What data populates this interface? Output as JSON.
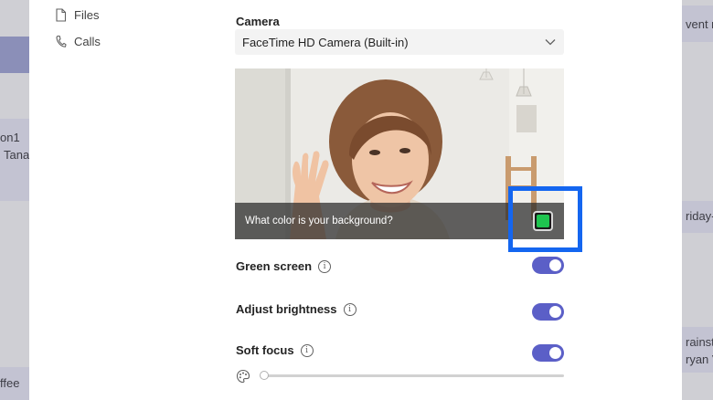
{
  "background_app": {
    "left_texts": [
      "on1",
      "Tana",
      "ffee"
    ],
    "right_texts": [
      "vent n",
      "riday-",
      "rainst",
      "ryan V"
    ]
  },
  "nav": {
    "files_label": "Files",
    "calls_label": "Calls"
  },
  "camera": {
    "label": "Camera",
    "selected_device": "FaceTime HD Camera (Built-in)"
  },
  "preview": {
    "prompt": "What color is your background?",
    "swatch_color": "#1ec44f"
  },
  "settings": [
    {
      "label": "Green screen",
      "enabled": true
    },
    {
      "label": "Adjust brightness",
      "enabled": true
    },
    {
      "label": "Soft focus",
      "enabled": true
    }
  ],
  "soft_focus_level": 0,
  "colors": {
    "accent": "#5b5fc7",
    "highlight": "#1466f0"
  }
}
